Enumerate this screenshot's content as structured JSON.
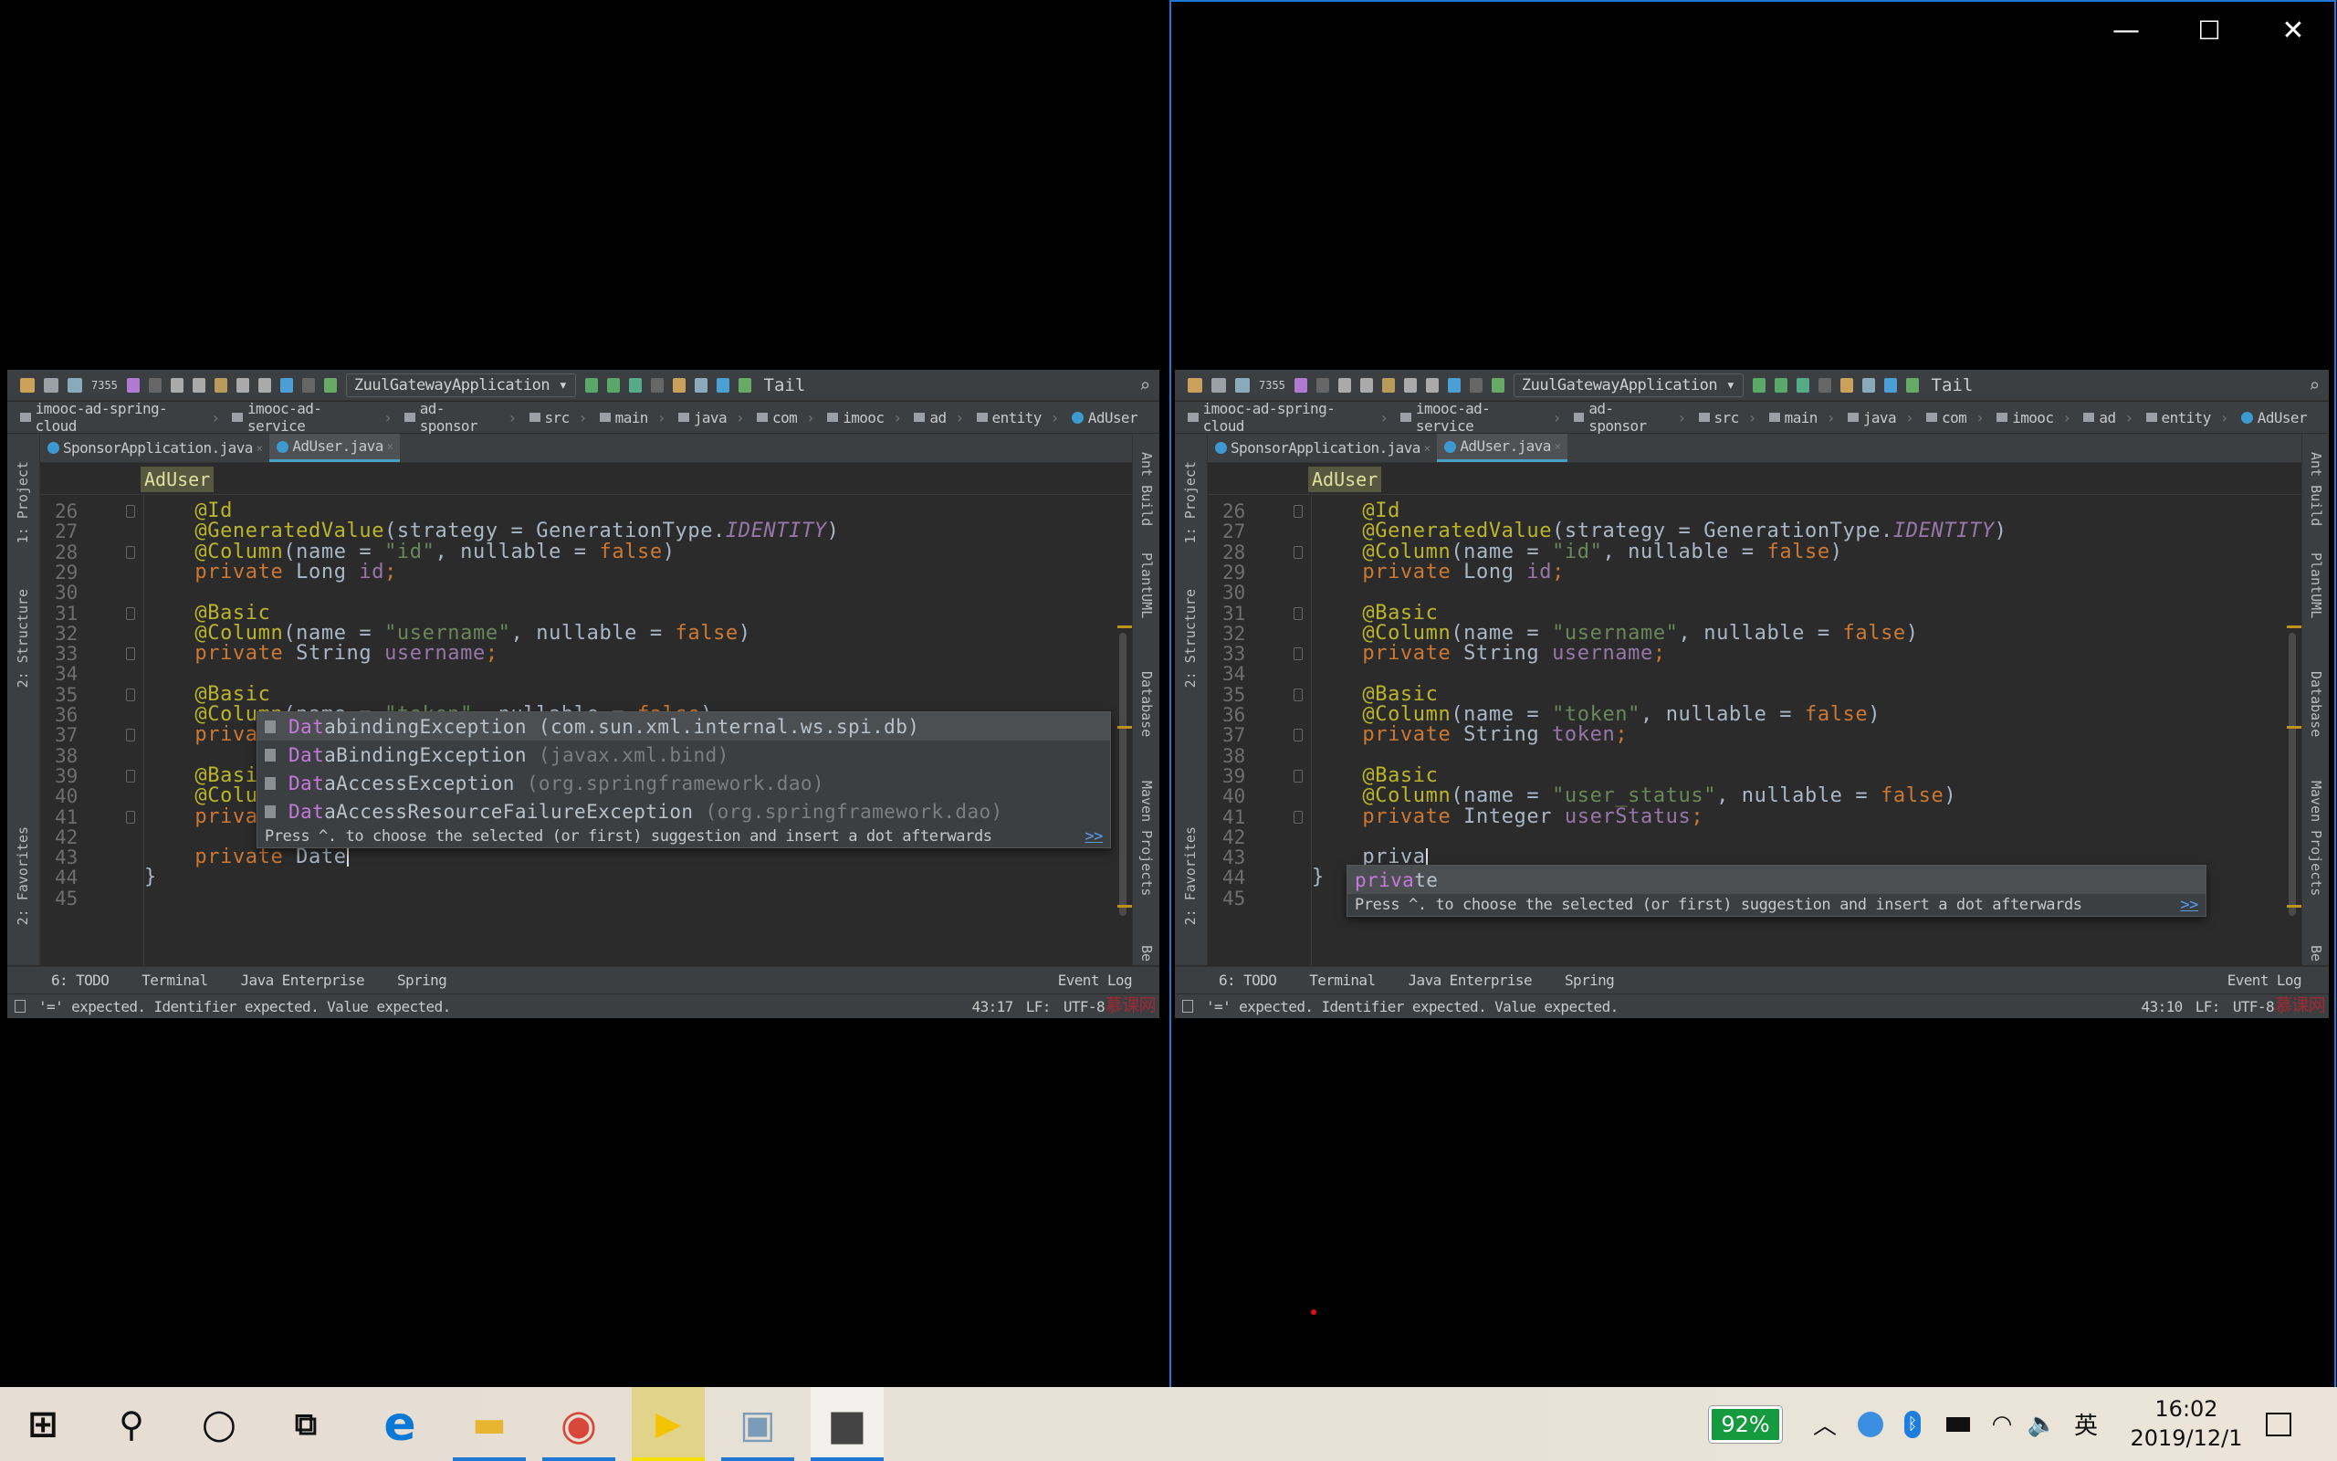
{
  "window_controls": {
    "minimize": "—",
    "maximize": "☐",
    "close": "✕"
  },
  "ide_left": {
    "toolbar": {
      "vcs": "7355",
      "run_config": "ZuulGatewayApplication ▾",
      "tail": "Tail"
    },
    "breadcrumb": [
      "imooc-ad-spring-cloud",
      "imooc-ad-service",
      "ad-sponsor",
      "src",
      "main",
      "java",
      "com",
      "imooc",
      "ad",
      "entity",
      "AdUser"
    ],
    "tabs": [
      {
        "label": "SponsorApplication.java",
        "active": false
      },
      {
        "label": "AdUser.java",
        "active": true
      }
    ],
    "left_tools": [
      "1: Project",
      "2: Structure",
      "2: Favorites"
    ],
    "right_tools": [
      "Ant Build",
      "PlantUML",
      "Database",
      "Maven Projects",
      "Be"
    ],
    "sticky": "AdUser",
    "lines": [
      {
        "n": "26",
        "t": [
          [
            "    ",
            ""
          ],
          [
            "@Id",
            "ann"
          ]
        ]
      },
      {
        "n": "27",
        "t": [
          [
            "    ",
            ""
          ],
          [
            "@GeneratedValue",
            "ann"
          ],
          [
            "(strategy = GenerationType.",
            "plain"
          ],
          [
            "IDENTITY",
            "const"
          ],
          [
            ")",
            "plain"
          ]
        ]
      },
      {
        "n": "28",
        "t": [
          [
            "    ",
            ""
          ],
          [
            "@Column",
            "ann"
          ],
          [
            "(name = ",
            "plain"
          ],
          [
            "\"id\"",
            "str"
          ],
          [
            ", nullable = ",
            "plain"
          ],
          [
            "false",
            "kw"
          ],
          [
            ")",
            "plain"
          ]
        ]
      },
      {
        "n": "29",
        "t": [
          [
            "    ",
            ""
          ],
          [
            "private ",
            "kw"
          ],
          [
            "Long ",
            "plain"
          ],
          [
            "id",
            "fld"
          ],
          [
            ";",
            "kw"
          ]
        ]
      },
      {
        "n": "30",
        "t": []
      },
      {
        "n": "31",
        "t": [
          [
            "    ",
            ""
          ],
          [
            "@Basic",
            "ann"
          ]
        ]
      },
      {
        "n": "32",
        "t": [
          [
            "    ",
            ""
          ],
          [
            "@Column",
            "ann"
          ],
          [
            "(name = ",
            "plain"
          ],
          [
            "\"username\"",
            "str"
          ],
          [
            ", nullable = ",
            "plain"
          ],
          [
            "false",
            "kw"
          ],
          [
            ")",
            "plain"
          ]
        ]
      },
      {
        "n": "33",
        "t": [
          [
            "    ",
            ""
          ],
          [
            "private ",
            "kw"
          ],
          [
            "String ",
            "plain"
          ],
          [
            "username",
            "fld"
          ],
          [
            ";",
            "kw"
          ]
        ]
      },
      {
        "n": "34",
        "t": []
      },
      {
        "n": "35",
        "t": [
          [
            "    ",
            ""
          ],
          [
            "@Basic",
            "ann"
          ]
        ]
      },
      {
        "n": "36",
        "t": [
          [
            "    ",
            ""
          ],
          [
            "@Column",
            "ann"
          ],
          [
            "(name = ",
            "plain"
          ],
          [
            "\"token\"",
            "str"
          ],
          [
            ", nullable = ",
            "plain"
          ],
          [
            "false",
            "kw"
          ],
          [
            ")",
            "plain"
          ]
        ]
      },
      {
        "n": "37",
        "t": [
          [
            "    ",
            ""
          ],
          [
            "private ",
            "kw"
          ],
          [
            "String ",
            "plain"
          ],
          [
            "token",
            "fld"
          ],
          [
            ";",
            "kw"
          ]
        ]
      },
      {
        "n": "38",
        "t": []
      },
      {
        "n": "39",
        "t": [
          [
            "    ",
            ""
          ],
          [
            "@Basic",
            "ann"
          ]
        ]
      },
      {
        "n": "40",
        "t": [
          [
            "    ",
            ""
          ],
          [
            "@Column",
            "ann"
          ],
          [
            "(name = ",
            "plain"
          ],
          [
            "\"user_status\"",
            "str"
          ],
          [
            ", nullable = ",
            "plain"
          ],
          [
            "false",
            "kw"
          ],
          [
            ")",
            "plain"
          ]
        ]
      },
      {
        "n": "41",
        "t": [
          [
            "    ",
            ""
          ],
          [
            "private ",
            "kw"
          ],
          [
            "Integer ",
            "plain"
          ],
          [
            "userStatus",
            "fld"
          ],
          [
            ";",
            "kw"
          ]
        ]
      },
      {
        "n": "42",
        "t": []
      },
      {
        "n": "43",
        "t": [
          [
            "    ",
            ""
          ],
          [
            "private ",
            "kw"
          ],
          [
            "Date",
            "plain"
          ]
        ],
        "caret": true
      },
      {
        "n": "44",
        "t": [
          [
            "}",
            "plain"
          ]
        ]
      },
      {
        "n": "45",
        "t": []
      }
    ],
    "completion": {
      "items": [
        {
          "match": "Dat",
          "rest": "abindingException",
          "pkg": " (com.sun.xml.internal.ws.spi.db)"
        },
        {
          "match": "Dat",
          "rest": "aBindingException",
          "pkg": " (javax.xml.bind)"
        },
        {
          "match": "Dat",
          "rest": "aAccessException",
          "pkg": " (org.springframework.dao)"
        },
        {
          "match": "Dat",
          "rest": "aAccessResourceFailureException",
          "pkg": " (org.springframework.dao)"
        }
      ],
      "hint": "Press ^. to choose the selected (or first) suggestion and insert a dot afterwards",
      "hint_link": ">>"
    },
    "bottom_tabs": [
      "6: TODO",
      "Terminal",
      "Java Enterprise",
      "Spring"
    ],
    "event_log": "Event Log",
    "status": {
      "message": "'=' expected. Identifier expected. Value expected.",
      "position": "43:17",
      "line_sep": "LF:",
      "encoding": "UTF-8"
    },
    "watermark": "慕课网"
  },
  "ide_right": {
    "toolbar": {
      "vcs": "7355",
      "run_config": "ZuulGatewayApplication ▾",
      "tail": "Tail"
    },
    "breadcrumb": [
      "imooc-ad-spring-cloud",
      "imooc-ad-service",
      "ad-sponsor",
      "src",
      "main",
      "java",
      "com",
      "imooc",
      "ad",
      "entity",
      "AdUser"
    ],
    "tabs": [
      {
        "label": "SponsorApplication.java",
        "active": false
      },
      {
        "label": "AdUser.java",
        "active": true
      }
    ],
    "left_tools": [
      "1: Project",
      "2: Structure",
      "2: Favorites"
    ],
    "right_tools": [
      "Ant Build",
      "PlantUML",
      "Database",
      "Maven Projects",
      "Be"
    ],
    "sticky": "AdUser",
    "lines": [
      {
        "n": "26",
        "t": [
          [
            "    ",
            ""
          ],
          [
            "@Id",
            "ann"
          ]
        ]
      },
      {
        "n": "27",
        "t": [
          [
            "    ",
            ""
          ],
          [
            "@GeneratedValue",
            "ann"
          ],
          [
            "(strategy = GenerationType.",
            "plain"
          ],
          [
            "IDENTITY",
            "const"
          ],
          [
            ")",
            "plain"
          ]
        ]
      },
      {
        "n": "28",
        "t": [
          [
            "    ",
            ""
          ],
          [
            "@Column",
            "ann"
          ],
          [
            "(name = ",
            "plain"
          ],
          [
            "\"id\"",
            "str"
          ],
          [
            ", nullable = ",
            "plain"
          ],
          [
            "false",
            "kw"
          ],
          [
            ")",
            "plain"
          ]
        ]
      },
      {
        "n": "29",
        "t": [
          [
            "    ",
            ""
          ],
          [
            "private ",
            "kw"
          ],
          [
            "Long ",
            "plain"
          ],
          [
            "id",
            "fld"
          ],
          [
            ";",
            "kw"
          ]
        ]
      },
      {
        "n": "30",
        "t": []
      },
      {
        "n": "31",
        "t": [
          [
            "    ",
            ""
          ],
          [
            "@Basic",
            "ann"
          ]
        ]
      },
      {
        "n": "32",
        "t": [
          [
            "    ",
            ""
          ],
          [
            "@Column",
            "ann"
          ],
          [
            "(name = ",
            "plain"
          ],
          [
            "\"username\"",
            "str"
          ],
          [
            ", nullable = ",
            "plain"
          ],
          [
            "false",
            "kw"
          ],
          [
            ")",
            "plain"
          ]
        ]
      },
      {
        "n": "33",
        "t": [
          [
            "    ",
            ""
          ],
          [
            "private ",
            "kw"
          ],
          [
            "String ",
            "plain"
          ],
          [
            "username",
            "fld"
          ],
          [
            ";",
            "kw"
          ]
        ]
      },
      {
        "n": "34",
        "t": []
      },
      {
        "n": "35",
        "t": [
          [
            "    ",
            ""
          ],
          [
            "@Basic",
            "ann"
          ]
        ]
      },
      {
        "n": "36",
        "t": [
          [
            "    ",
            ""
          ],
          [
            "@Column",
            "ann"
          ],
          [
            "(name = ",
            "plain"
          ],
          [
            "\"token\"",
            "str"
          ],
          [
            ", nullable = ",
            "plain"
          ],
          [
            "false",
            "kw"
          ],
          [
            ")",
            "plain"
          ]
        ]
      },
      {
        "n": "37",
        "t": [
          [
            "    ",
            ""
          ],
          [
            "private ",
            "kw"
          ],
          [
            "String ",
            "plain"
          ],
          [
            "token",
            "fld"
          ],
          [
            ";",
            "kw"
          ]
        ]
      },
      {
        "n": "38",
        "t": []
      },
      {
        "n": "39",
        "t": [
          [
            "    ",
            ""
          ],
          [
            "@Basic",
            "ann"
          ]
        ]
      },
      {
        "n": "40",
        "t": [
          [
            "    ",
            ""
          ],
          [
            "@Column",
            "ann"
          ],
          [
            "(name = ",
            "plain"
          ],
          [
            "\"user_status\"",
            "str"
          ],
          [
            ", nullable = ",
            "plain"
          ],
          [
            "false",
            "kw"
          ],
          [
            ")",
            "plain"
          ]
        ]
      },
      {
        "n": "41",
        "t": [
          [
            "    ",
            ""
          ],
          [
            "private ",
            "kw"
          ],
          [
            "Integer ",
            "plain"
          ],
          [
            "userStatus",
            "fld"
          ],
          [
            ";",
            "kw"
          ]
        ]
      },
      {
        "n": "42",
        "t": []
      },
      {
        "n": "43",
        "t": [
          [
            "    ",
            ""
          ],
          [
            "priva",
            "plain"
          ]
        ],
        "caret": true
      },
      {
        "n": "44",
        "t": [
          [
            "}",
            "plain"
          ]
        ]
      },
      {
        "n": "45",
        "t": []
      }
    ],
    "completion": {
      "items": [
        {
          "match": "priva",
          "rest": "te",
          "pkg": ""
        }
      ],
      "hint": "Press ^. to choose the selected (or first) suggestion and insert a dot afterwards",
      "hint_link": ">>"
    },
    "bottom_tabs": [
      "6: TODO",
      "Terminal",
      "Java Enterprise",
      "Spring"
    ],
    "event_log": "Event Log",
    "status": {
      "message": "'=' expected. Identifier expected. Value expected.",
      "position": "43:10",
      "line_sep": "LF:",
      "encoding": "UTF-8"
    },
    "watermark": "慕课网"
  },
  "taskbar": {
    "apps": [
      {
        "name": "start-button",
        "icon": "windows-icon"
      },
      {
        "name": "search-button",
        "icon": "search-icon"
      },
      {
        "name": "cortana-button",
        "icon": "cortana-icon"
      },
      {
        "name": "task-view-button",
        "icon": "task-view-icon"
      },
      {
        "name": "edge-app",
        "icon": "edge-icon"
      },
      {
        "name": "file-explorer-app",
        "icon": "folder-icon",
        "running": true
      },
      {
        "name": "chrome-app",
        "icon": "chrome-icon",
        "running": true
      },
      {
        "name": "player-app",
        "icon": "player-icon",
        "running": true
      },
      {
        "name": "resource-monitor-app",
        "icon": "monitor-icon",
        "running": true
      },
      {
        "name": "video-editor-app",
        "icon": "clapperboard-icon",
        "running": true
      }
    ],
    "battery_percent": "92%",
    "ime": "英",
    "time": "16:02",
    "date": "2019/12/1"
  },
  "colors": {
    "editor_bg": "#2b2b2b",
    "panel_bg": "#3c3f41",
    "keyword": "#cc7832",
    "annotation": "#bbb529",
    "string": "#6a8759",
    "field": "#9876aa",
    "accent": "#1e78d4",
    "battery": "#169a3e"
  }
}
